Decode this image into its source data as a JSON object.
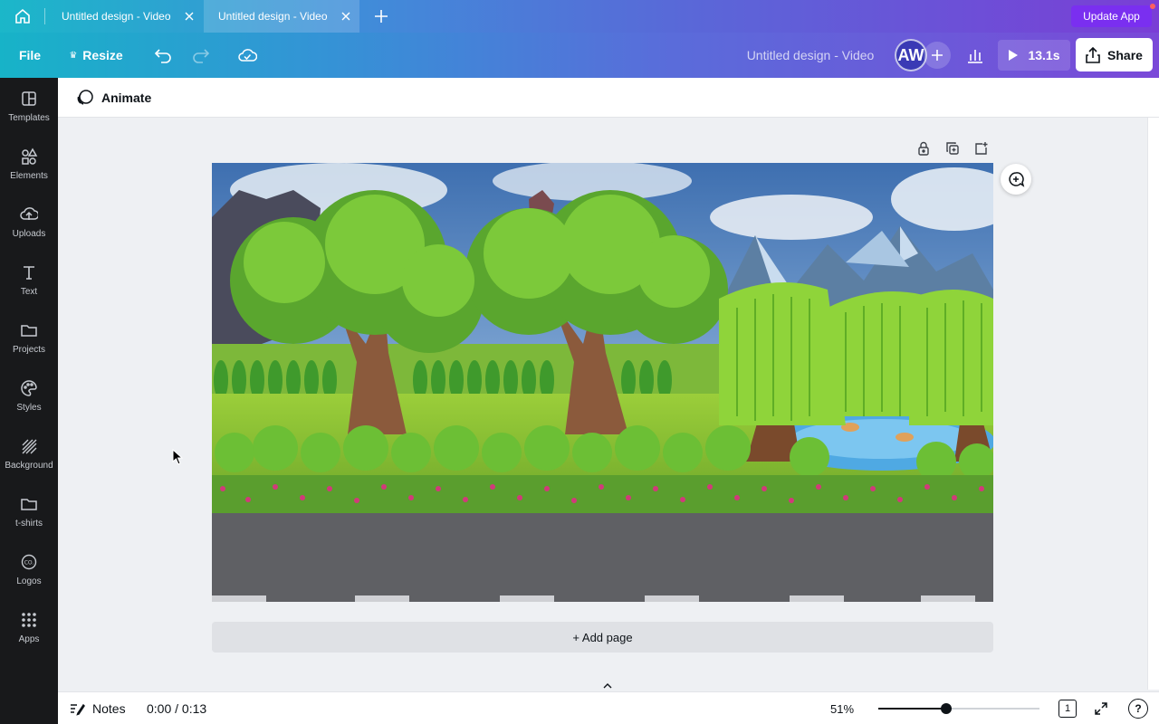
{
  "tabs": [
    {
      "label": "Untitled design - Video"
    },
    {
      "label": "Untitled design - Video"
    }
  ],
  "update_app_label": "Update App",
  "toolbar": {
    "file_label": "File",
    "resize_label": "Resize",
    "design_title": "Untitled design - Video",
    "avatar_initials": "AW",
    "play_duration": "13.1s",
    "share_label": "Share"
  },
  "sidebar": {
    "items": [
      {
        "label": "Templates",
        "icon": "templates-icon"
      },
      {
        "label": "Elements",
        "icon": "elements-icon"
      },
      {
        "label": "Uploads",
        "icon": "uploads-icon"
      },
      {
        "label": "Text",
        "icon": "text-icon"
      },
      {
        "label": "Projects",
        "icon": "projects-icon"
      },
      {
        "label": "Styles",
        "icon": "styles-icon"
      },
      {
        "label": "Background",
        "icon": "background-icon"
      },
      {
        "label": "t-shirts",
        "icon": "tshirts-icon"
      },
      {
        "label": "Logos",
        "icon": "logos-icon"
      },
      {
        "label": "Apps",
        "icon": "apps-icon"
      }
    ]
  },
  "subbar": {
    "animate_label": "Animate"
  },
  "canvas": {
    "add_page_label": "+ Add page"
  },
  "footer": {
    "notes_label": "Notes",
    "timecode": "0:00 / 0:13",
    "zoom_label": "51%",
    "zoom_fraction": 0.42,
    "page_count": "1",
    "help_label": "?"
  },
  "colors": {
    "sidebar_bg": "#18191b",
    "update_btn": "#7a2ff0",
    "gradient_start": "#17b3c8",
    "gradient_end": "#7a49d8"
  }
}
